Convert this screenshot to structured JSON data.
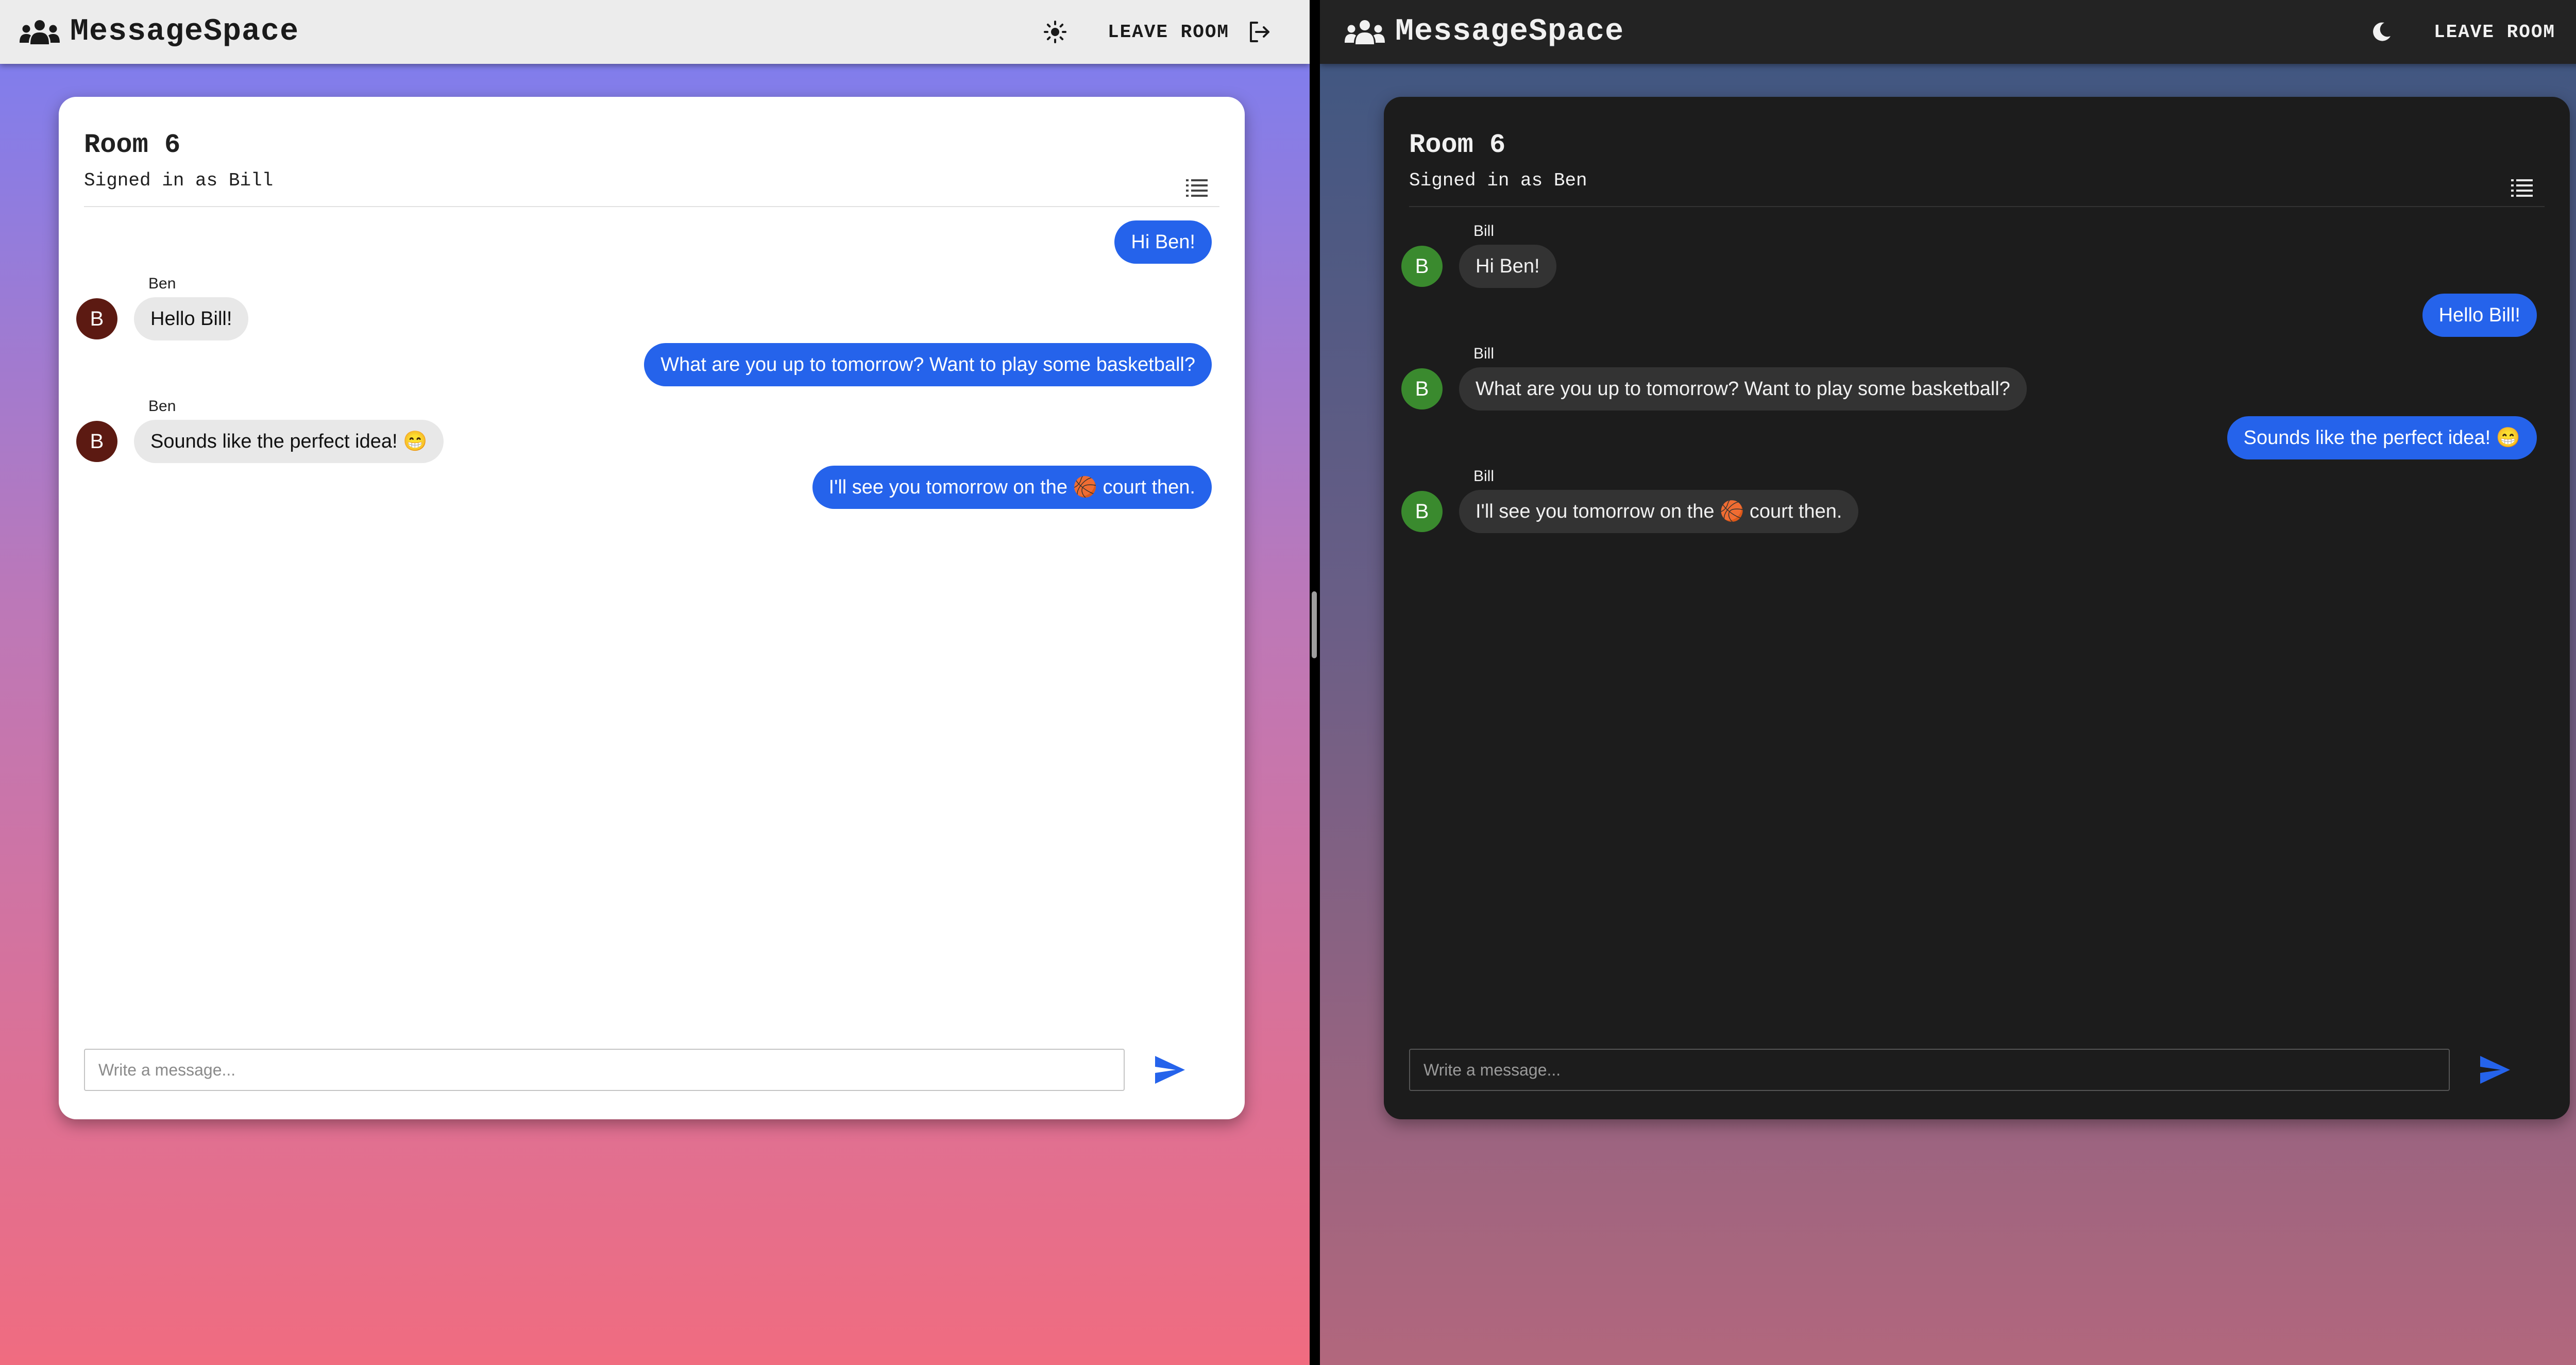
{
  "colors": {
    "accent": "#2563eb",
    "light_avatar": "#5c1a12",
    "dark_avatar": "#3a8a2e"
  },
  "light": {
    "app_title": "MessageSpace",
    "theme_icon": "sun-icon",
    "leave_label": "LEAVE ROOM",
    "room_title": "Room 6",
    "signed_in": "Signed in as Bill",
    "placeholder": "Write a message...",
    "messages": [
      {
        "self": true,
        "text": "Hi Ben!"
      },
      {
        "self": false,
        "sender": "Ben",
        "avatar": "B",
        "text": "Hello Bill!"
      },
      {
        "self": true,
        "text": "What are you up to tomorrow? Want to play some basketball?"
      },
      {
        "self": false,
        "sender": "Ben",
        "avatar": "B",
        "text": "Sounds like the perfect idea! 😁"
      },
      {
        "self": true,
        "text": "I'll see you tomorrow on the 🏀 court then."
      }
    ]
  },
  "dark": {
    "app_title": "MessageSpace",
    "theme_icon": "moon-icon",
    "leave_label": "LEAVE ROOM",
    "room_title": "Room 6",
    "signed_in": "Signed in as Ben",
    "placeholder": "Write a message...",
    "messages": [
      {
        "self": false,
        "sender": "Bill",
        "avatar": "B",
        "text": "Hi Ben!"
      },
      {
        "self": true,
        "text": "Hello Bill!"
      },
      {
        "self": false,
        "sender": "Bill",
        "avatar": "B",
        "text": "What are you up to tomorrow? Want to play some basketball?"
      },
      {
        "self": true,
        "text": "Sounds like the perfect idea! 😁"
      },
      {
        "self": false,
        "sender": "Bill",
        "avatar": "B",
        "text": "I'll see you tomorrow on the 🏀 court then."
      }
    ]
  }
}
